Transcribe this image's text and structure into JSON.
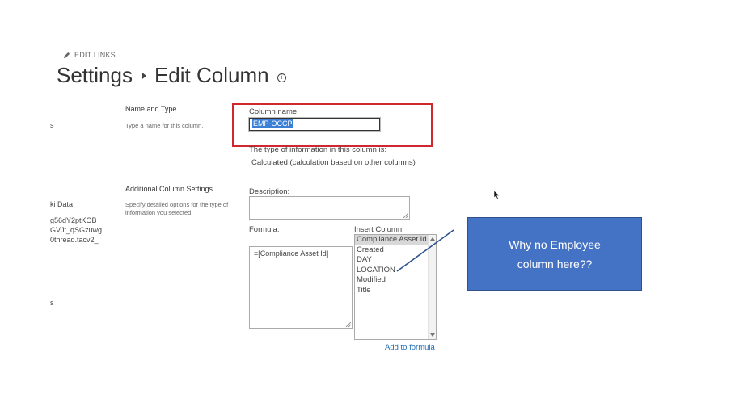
{
  "header": {
    "edit_links": "EDIT LINKS",
    "breadcrumb_root": "Settings",
    "page_title": "Edit Column"
  },
  "left_nav": {
    "fragments": [
      "s",
      "ki Data",
      "g56dY2ptKOB",
      "GVJt_qSGzuwg",
      "0thread.tacv2_",
      "s"
    ]
  },
  "name_section": {
    "title": "Name and Type",
    "description": "Type a name for this column.",
    "column_name_label": "Column name:",
    "column_name_value": "EMP-OCCP",
    "type_label": "The type of information in this column is:",
    "type_value": "Calculated (calculation based on other columns)"
  },
  "additional_section": {
    "title": "Additional Column Settings",
    "description_line1": "Specify detailed options for the type of",
    "description_line2": "information you selected.",
    "description_label": "Description:",
    "formula_label": "Formula:",
    "formula_value": "=[Compliance Asset Id]",
    "insert_column_label": "Insert Column:",
    "insert_columns": [
      {
        "label": "Compliance Asset Id",
        "selected": true
      },
      {
        "label": "Created",
        "selected": false
      },
      {
        "label": "DAY",
        "selected": false
      },
      {
        "label": "LOCATION",
        "selected": false
      },
      {
        "label": "Modified",
        "selected": false
      },
      {
        "label": "Title",
        "selected": false
      }
    ],
    "add_to_formula": "Add to formula"
  },
  "annotation": {
    "line1": "Why no Employee",
    "line2": "column here??",
    "fill_color": "#4472c4",
    "highlight_color": "#d0282e"
  }
}
